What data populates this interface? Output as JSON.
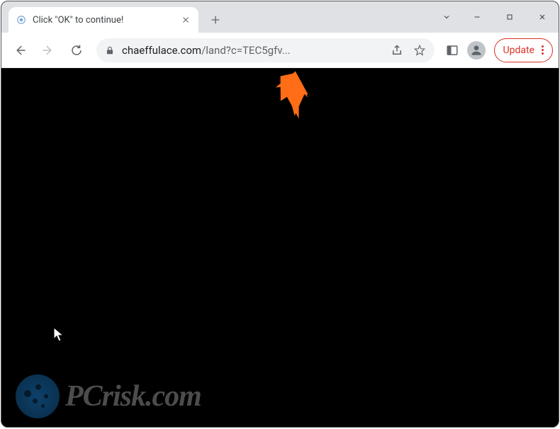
{
  "window": {
    "tab_title": "Click \"OK\" to continue!"
  },
  "address": {
    "domain": "chaeffulace.com",
    "path": "/land?c=TEC5gfv..."
  },
  "update": {
    "label": "Update"
  },
  "watermark": {
    "text": "PCrisk.com"
  }
}
